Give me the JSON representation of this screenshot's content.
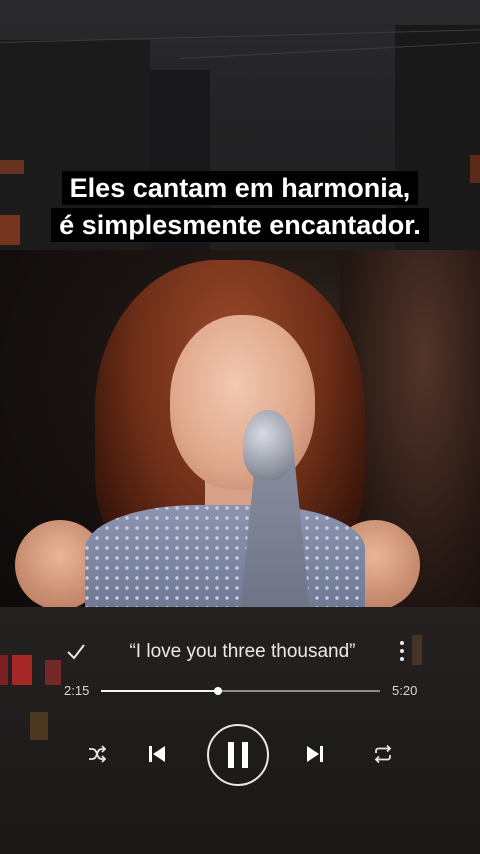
{
  "caption": {
    "line1": "Eles cantam em harmonia,",
    "line2": "é simplesmente encantador."
  },
  "player": {
    "song_title": "“I love you three thousand”",
    "time_elapsed": "2:15",
    "time_total": "5:20",
    "progress_fraction": 0.42,
    "icons": {
      "like": "check-icon",
      "more": "more-vertical-icon",
      "shuffle": "shuffle-icon",
      "previous": "skip-previous-icon",
      "play_pause": "pause-icon",
      "next": "skip-next-icon",
      "repeat": "repeat-icon"
    }
  },
  "colors": {
    "accent": "#ffffff",
    "track": "#8c8c8c",
    "caption_bg": "#000000"
  }
}
